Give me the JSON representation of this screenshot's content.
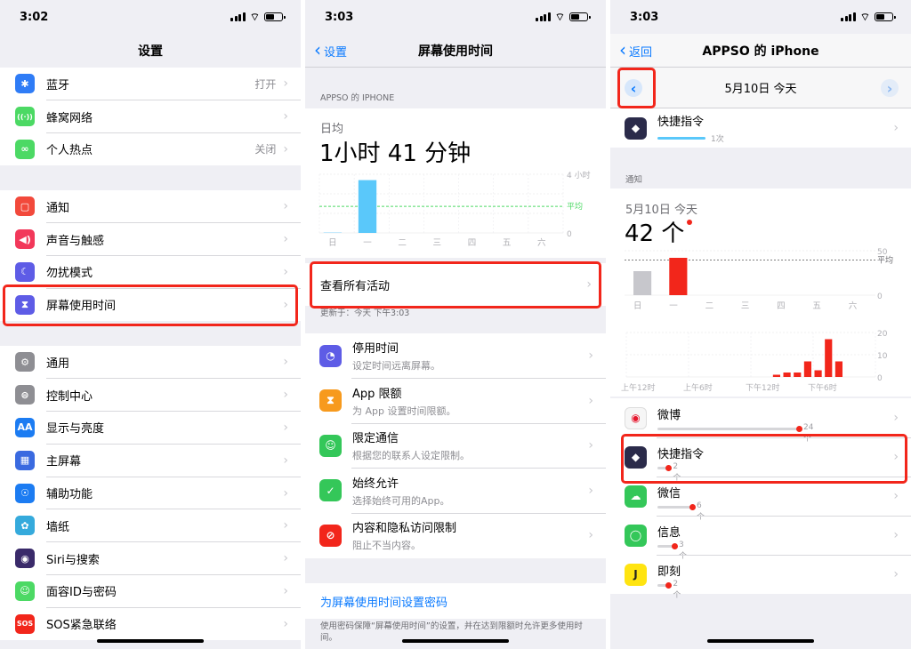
{
  "screen1": {
    "status_time": "3:02",
    "title": "设置",
    "group1": [
      {
        "label": "蓝牙",
        "value": "打开",
        "icon": "bluetooth-icon",
        "color": "#2f7cf6",
        "glyph": "✱"
      },
      {
        "label": "蜂窝网络",
        "value": "",
        "icon": "cellular-icon",
        "color": "#4cd964",
        "glyph": "((·))"
      },
      {
        "label": "个人热点",
        "value": "关闭",
        "icon": "hotspot-icon",
        "color": "#4cd964",
        "glyph": "∞"
      }
    ],
    "group2": [
      {
        "label": "通知",
        "value": "",
        "icon": "notifications-icon",
        "color": "#f2493b",
        "glyph": "▢"
      },
      {
        "label": "声音与触感",
        "value": "",
        "icon": "sound-icon",
        "color": "#f2385a",
        "glyph": "◀)"
      },
      {
        "label": "勿扰模式",
        "value": "",
        "icon": "moon-icon",
        "color": "#5e5ce6",
        "glyph": "☾"
      },
      {
        "label": "屏幕使用时间",
        "value": "",
        "icon": "hourglass-icon",
        "color": "#5e5ce6",
        "glyph": "⧗"
      }
    ],
    "group3": [
      {
        "label": "通用",
        "value": "",
        "icon": "gear-icon",
        "color": "#8e8e93",
        "glyph": "⚙"
      },
      {
        "label": "控制中心",
        "value": "",
        "icon": "switches-icon",
        "color": "#8e8e93",
        "glyph": "⊜"
      },
      {
        "label": "显示与亮度",
        "value": "",
        "icon": "display-icon",
        "color": "#1c7cf2",
        "glyph": "AA"
      },
      {
        "label": "主屏幕",
        "value": "",
        "icon": "home-screen-icon",
        "color": "#3a6ae0",
        "glyph": "▦"
      },
      {
        "label": "辅助功能",
        "value": "",
        "icon": "accessibility-icon",
        "color": "#1c7cf2",
        "glyph": "☉"
      },
      {
        "label": "墙纸",
        "value": "",
        "icon": "wallpaper-icon",
        "color": "#35aadc",
        "glyph": "✿"
      },
      {
        "label": "Siri与搜索",
        "value": "",
        "icon": "siri-icon",
        "color": "#3a2a6a",
        "glyph": "◉"
      },
      {
        "label": "面容ID与密码",
        "value": "",
        "icon": "face-id-icon",
        "color": "#4cd964",
        "glyph": "☺"
      },
      {
        "label": "SOS紧急联络",
        "value": "",
        "icon": "sos-icon",
        "color": "#f2261b",
        "glyph": "SOS"
      }
    ]
  },
  "screen2": {
    "status_time": "3:03",
    "back_label": "设置",
    "title": "屏幕使用时间",
    "device_header": "APPSO 的 IPHONE",
    "avg_label": "日均",
    "avg_value": "1小时 41 分钟",
    "chart_max_label": "4 小时",
    "chart_avg_label": "平均",
    "chart_zero_label": "0",
    "days": [
      "日",
      "一",
      "二",
      "三",
      "四",
      "五",
      "六"
    ],
    "day_values": [
      0.02,
      3.6,
      0,
      0,
      0,
      0,
      0
    ],
    "see_all": "查看所有活动",
    "updated": "更新于：今天 下午3:03",
    "options": [
      {
        "title": "停用时间",
        "sub": "设定时间远离屏幕。",
        "icon": "downtime-icon",
        "color": "#5e5ce6",
        "glyph": "◔"
      },
      {
        "title": "App 限额",
        "sub": "为 App 设置时间限额。",
        "icon": "hourglass-icon",
        "color": "#f79a1d",
        "glyph": "⧗"
      },
      {
        "title": "限定通信",
        "sub": "根据您的联系人设定限制。",
        "icon": "contact-icon",
        "color": "#34c759",
        "glyph": "☺"
      },
      {
        "title": "始终允许",
        "sub": "选择始终可用的App。",
        "icon": "checkmark-icon",
        "color": "#34c759",
        "glyph": "✓"
      },
      {
        "title": "内容和隐私访问限制",
        "sub": "阻止不当内容。",
        "icon": "restriction-icon",
        "color": "#f2261b",
        "glyph": "⊘"
      }
    ],
    "passcode_link": "为屏幕使用时间设置密码",
    "passcode_note": "使用密码保障“屏幕使用时间”的设置，并在达到限额时允许更多使用时间。"
  },
  "screen3": {
    "status_time": "3:03",
    "back_label": "返回",
    "title": "APPSO 的 iPhone",
    "date_label": "5月10日 今天",
    "top_app": {
      "name": "快捷指令",
      "count": "1次"
    },
    "section": "通知",
    "notif_date": "5月10日 今天",
    "notif_count": "42 个",
    "week_axis_max": "50",
    "week_axis_zero": "0",
    "week_avg_label": "平均",
    "week_days": [
      "日",
      "一",
      "二",
      "三",
      "四",
      "五",
      "六"
    ],
    "week_values": [
      27,
      42,
      0,
      0,
      0,
      0,
      0
    ],
    "hour_axis": [
      "20",
      "10",
      "0"
    ],
    "hour_labels": [
      "上午12时",
      "上午6时",
      "下午12时",
      "下午6时"
    ],
    "hour_values": [
      0,
      0,
      0,
      0,
      0,
      0,
      0,
      0,
      0,
      0,
      0,
      0,
      0,
      0,
      1,
      2,
      2,
      7,
      3,
      17,
      7,
      0,
      0,
      0
    ],
    "apps": [
      {
        "name": "微博",
        "count": "24 个",
        "value": 24,
        "icon": "weibo-icon",
        "color": "#f6f6f6",
        "glyph": "◉"
      },
      {
        "name": "快捷指令",
        "count": "2 个",
        "value": 2,
        "icon": "shortcuts-icon",
        "color": "#2b2b4a",
        "glyph": "◆"
      },
      {
        "name": "微信",
        "count": "6 个",
        "value": 6,
        "icon": "wechat-icon",
        "color": "#34c759",
        "glyph": "☁"
      },
      {
        "name": "信息",
        "count": "3 个",
        "value": 3,
        "icon": "messages-icon",
        "color": "#34c759",
        "glyph": "◯"
      },
      {
        "name": "即刻",
        "count": "2 个",
        "value": 2,
        "icon": "jike-icon",
        "color": "#ffe411",
        "glyph": "J"
      }
    ]
  },
  "colors": {
    "ios_blue": "#0a7aff",
    "highlight_red": "#f2261b",
    "chart_blue": "#5ac8fa",
    "chart_gray": "#c7c7cc",
    "avg_green": "#4cd964"
  }
}
